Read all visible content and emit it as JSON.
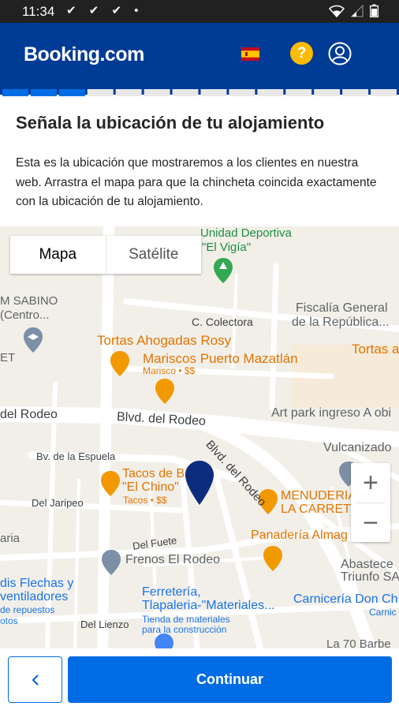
{
  "status_bar": {
    "time": "11:34",
    "notifications": "✔ ✔ ✔ •"
  },
  "header": {
    "logo": "Booking.com",
    "help": "?"
  },
  "progress": {
    "total_steps": 14,
    "completed_steps": 3
  },
  "content": {
    "title": "Señala la ubicación de tu alojamiento",
    "description": "Esta es la ubicación que mostraremos a los clientes en nuestra web. Arrastra el mapa para que la chincheta coincida exactamente con la ubicación de tu alojamiento."
  },
  "map": {
    "tabs": [
      "Mapa",
      "Satélite"
    ],
    "zoom_in": "+",
    "zoom_out": "−",
    "labels": {
      "unidad_deportiva": "Unidad Deportiva",
      "el_vigia": "\"El Vigía\"",
      "m_sabino": "M SABINO",
      "centro": "(Centro...",
      "fiscalia": "Fiscalía General",
      "republica": "de la República...",
      "c_colectora": "C. Colectora",
      "tortas_rosy": "Tortas Ahogadas Rosy",
      "tortas_a": "Tortas a",
      "mariscos": "Mariscos Puerto Mazatlán",
      "marisco_sub": "Marisco • $$",
      "et": "ET",
      "del_rodeo_left": "del Rodeo",
      "blvd_rodeo": "Blvd. del Rodeo",
      "blvd_rodeo_diag": "Blvd. del Rodeo",
      "art_park": "Art park ingreso A obi",
      "vulcanizado": "Vulcanizado",
      "espuela": "Bv. de la Espuela",
      "tacos_1": "Tacos de B",
      "tacos_2": "\"El Chino\"",
      "tacos_sub": "Tacos • $$",
      "jaripeo": "Del Jaripeo",
      "menuderia_1": "MENUDERIA",
      "menuderia_2": "LA CARRET",
      "aria": "aria",
      "panaderia": "Panadería Almag",
      "fuete": "Del Fuete",
      "frenos": "Frenos El Rodeo",
      "abastece": "Abastece",
      "triunfo": "Triunfo SA",
      "flechas": "dis Flechas y",
      "ventiladores": "ventiladores",
      "repuestos": "de repuestos",
      "otos": "otos",
      "ferreteria_1": "Ferretería,",
      "ferreteria_2": "Tlapaleria-\"Materiales...",
      "ferreteria_sub1": "Tienda de materiales",
      "ferreteria_sub2": "para la construcción",
      "carniceria": "Carnicería Don Ch",
      "carnic": "Carnic",
      "lienzo": "Del Lienzo",
      "barbe": "La 70 Barbe"
    }
  },
  "footer": {
    "back_icon": "chevron-left-icon",
    "continue": "Continuar"
  },
  "colors": {
    "brand_dark": "#003b95",
    "brand_blue": "#006ce4",
    "help_yellow": "#febb02",
    "pin": "#0d2c7e"
  }
}
